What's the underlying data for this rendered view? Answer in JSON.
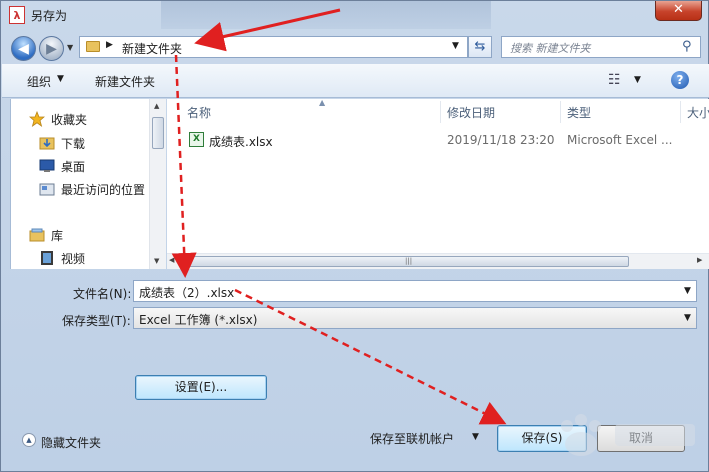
{
  "window": {
    "title": "另存为",
    "close_glyph": "✕"
  },
  "nav": {
    "back_glyph": "◀",
    "forward_glyph": "▶",
    "path": [
      "新建文件夹"
    ],
    "search_placeholder": "搜索 新建文件夹"
  },
  "toolbar": {
    "organize_label": "组织",
    "new_folder_label": "新建文件夹",
    "help_label": "?"
  },
  "sidebar": {
    "items": [
      {
        "label": "收藏夹",
        "icon": "star-icon"
      },
      {
        "label": "下载",
        "icon": "download-folder-icon"
      },
      {
        "label": "桌面",
        "icon": "desktop-icon"
      },
      {
        "label": "最近访问的位置",
        "icon": "recent-places-icon"
      },
      {
        "label": "库",
        "icon": "library-icon"
      },
      {
        "label": "视频",
        "icon": "video-icon"
      }
    ]
  },
  "file_list": {
    "columns": [
      "名称",
      "修改日期",
      "类型",
      "大小"
    ],
    "rows": [
      {
        "name": "成绩表.xlsx",
        "modified": "2019/11/18 23:20",
        "type": "Microsoft Excel ...",
        "icon": "excel-file-icon"
      }
    ]
  },
  "form": {
    "filename_label": "文件名(N):",
    "filename_value": "成绩表（2）.xlsx",
    "filetype_label": "保存类型(T):",
    "filetype_value": "Excel 工作簿 (*.xlsx)",
    "settings_button": "设置(E)..."
  },
  "footer": {
    "hide_folders_label": "隐藏文件夹",
    "save_online_label": "保存至联机帐户",
    "save_button": "保存(S)",
    "cancel_button": "取消"
  },
  "colors": {
    "annotation_arrow": "#e02020",
    "accent": "#2e6cc2"
  }
}
